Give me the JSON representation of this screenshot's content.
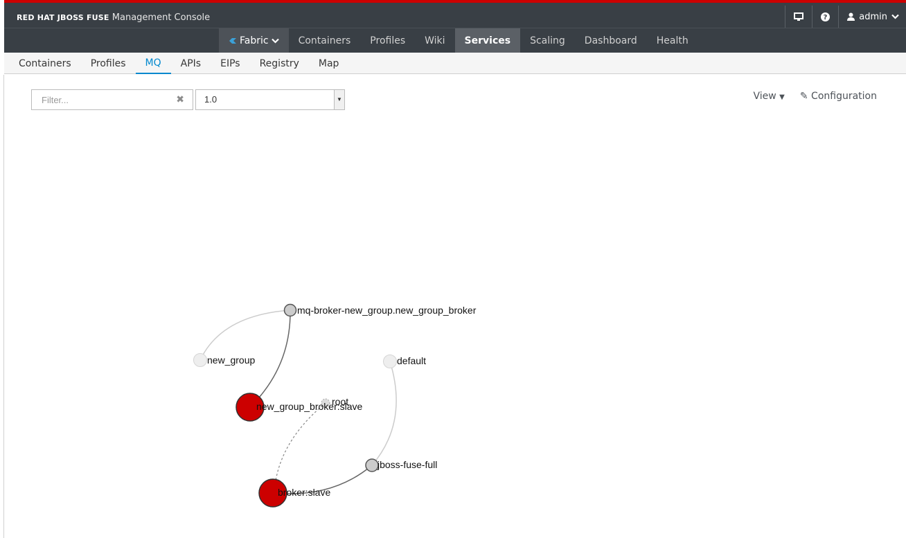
{
  "header": {
    "brand_bold": "RED HAT JBOSS FUSE",
    "brand_title": "Management Console",
    "user": "admin"
  },
  "main_nav": [
    {
      "label": "Fabric"
    },
    {
      "label": "Containers"
    },
    {
      "label": "Profiles"
    },
    {
      "label": "Wiki"
    },
    {
      "label": "Services"
    },
    {
      "label": "Scaling"
    },
    {
      "label": "Dashboard"
    },
    {
      "label": "Health"
    }
  ],
  "sub_nav": [
    {
      "label": "Containers"
    },
    {
      "label": "Profiles"
    },
    {
      "label": "MQ"
    },
    {
      "label": "APIs"
    },
    {
      "label": "EIPs"
    },
    {
      "label": "Registry"
    },
    {
      "label": "Map"
    }
  ],
  "toolbar": {
    "filter_placeholder": "Filter...",
    "version": "1.0",
    "view_label": "View",
    "configuration_label": "Configuration"
  },
  "graph": {
    "nodes": [
      {
        "label": "mq-broker-new_group.new_group_broker",
        "kind": "profile"
      },
      {
        "label": "new_group",
        "kind": "group"
      },
      {
        "label": "default",
        "kind": "group"
      },
      {
        "label": "new_group_broker:slave",
        "kind": "broker"
      },
      {
        "label": "root",
        "kind": "container"
      },
      {
        "label": "jboss-fuse-full",
        "kind": "profile"
      },
      {
        "label": "broker:slave",
        "kind": "broker"
      }
    ],
    "colors": {
      "broker": "#cc0000",
      "profile": "#cccccc",
      "group": "#eeeeee",
      "edge_dark": "#666666",
      "edge_light": "#cccccc"
    }
  },
  "colors": {
    "topbar": "#393f45",
    "accent_red": "#cc0000",
    "active_tab": "#0088ce"
  }
}
